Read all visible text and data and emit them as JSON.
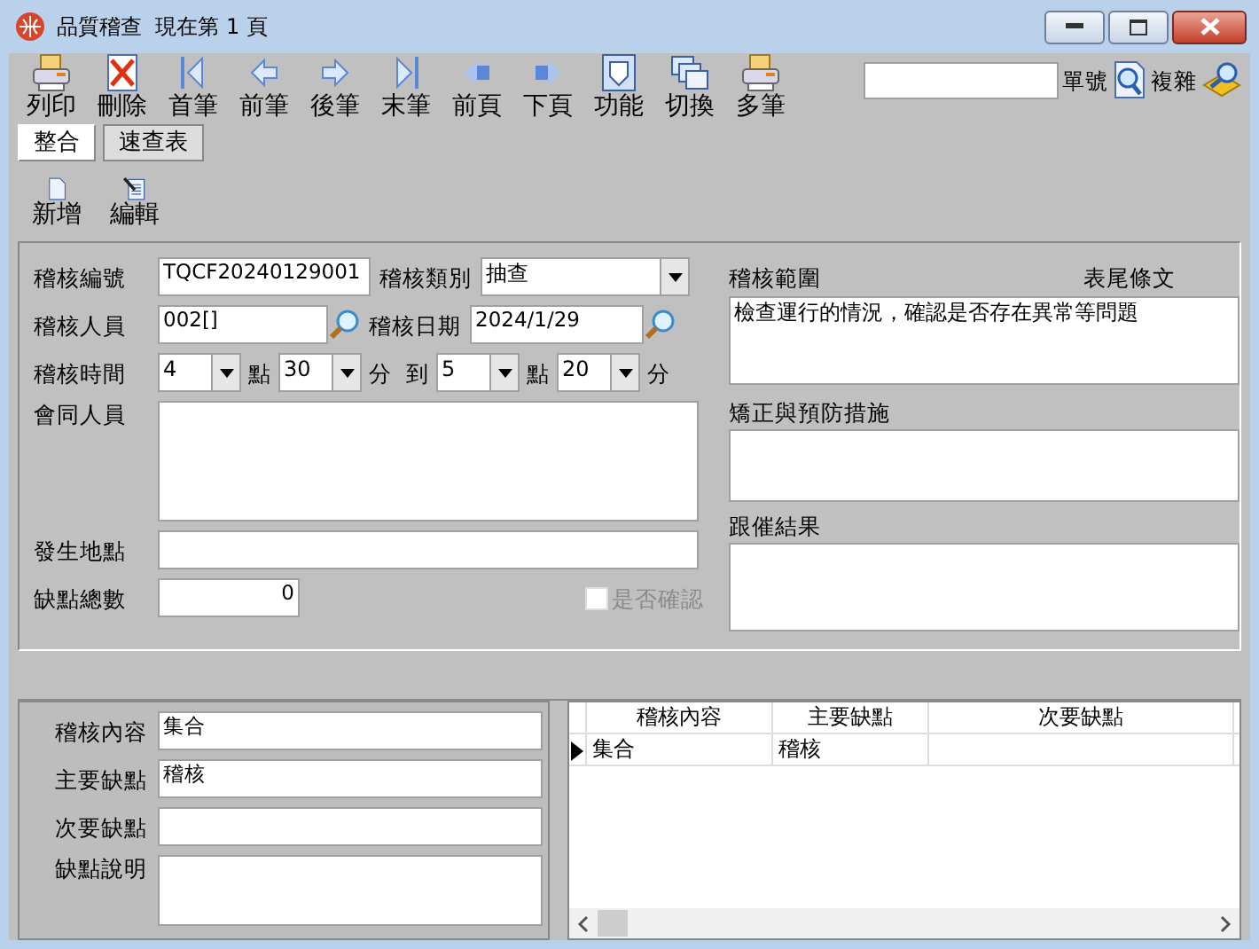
{
  "window": {
    "title": "品質稽查  現在第 1 頁"
  },
  "toolbar": [
    {
      "label": "列印",
      "kind": "print"
    },
    {
      "label": "刪除",
      "kind": "delete"
    },
    {
      "label": "首筆",
      "kind": "first"
    },
    {
      "label": "前筆",
      "kind": "prev"
    },
    {
      "label": "後筆",
      "kind": "next"
    },
    {
      "label": "末筆",
      "kind": "last"
    },
    {
      "label": "前頁",
      "kind": "prev_page"
    },
    {
      "label": "下頁",
      "kind": "next_page"
    },
    {
      "label": "功能",
      "kind": "function"
    },
    {
      "label": "切換",
      "kind": "switch"
    },
    {
      "label": "多筆",
      "kind": "print"
    }
  ],
  "search": {
    "label": "單號",
    "advanced_label": "複雜"
  },
  "tabs": [
    {
      "label": "整合",
      "selected": true
    },
    {
      "label": "速查表",
      "selected": false
    }
  ],
  "actions": [
    {
      "label": "新增",
      "kind": "new"
    },
    {
      "label": "編輯",
      "kind": "edit"
    }
  ],
  "form": {
    "audit_no": {
      "label": "稽核編號",
      "value": "TQCF20240129001"
    },
    "category": {
      "label": "稽核類別",
      "value": "抽查"
    },
    "auditor": {
      "label": "稽核人員",
      "value": "002[]"
    },
    "date": {
      "label": "稽核日期",
      "value": "2024/1/29"
    },
    "time": {
      "label": "稽核時間",
      "parts": [
        {
          "kind": "select",
          "value": "4"
        },
        {
          "kind": "text",
          "text": "點"
        },
        {
          "kind": "select",
          "value": "30"
        },
        {
          "kind": "text",
          "text": "分"
        },
        {
          "kind": "text",
          "text": "到"
        },
        {
          "kind": "select",
          "value": "5"
        },
        {
          "kind": "text",
          "text": "點"
        },
        {
          "kind": "select",
          "value": "20"
        },
        {
          "kind": "text",
          "text": "分"
        }
      ]
    },
    "participants": {
      "label": "會同人員"
    },
    "location": {
      "label": "發生地點"
    },
    "defect_total": {
      "label": "缺點總數",
      "value": "0"
    },
    "confirmed": {
      "label": "是否確認",
      "checked": false,
      "disabled": true
    },
    "scope": {
      "label": "稽核範圍",
      "footer_label": "表尾條文",
      "value": "檢查運行的情況，確認是否存在異常等問題"
    },
    "corrective": {
      "label": "矯正與預防措施"
    },
    "follow_up": {
      "label": "跟催結果"
    }
  },
  "detail": [
    {
      "label": "稽核內容",
      "value": "集合",
      "kind": "input"
    },
    {
      "label": "主要缺點",
      "value": "稽核",
      "kind": "input"
    },
    {
      "label": "次要缺點",
      "kind": "input"
    },
    {
      "label": "缺點說明",
      "kind": "textarea"
    }
  ],
  "grid": {
    "columns": [
      "稽核內容",
      "主要缺點",
      "次要缺點"
    ],
    "rows": [
      {
        "cells": [
          "集合",
          "稽核"
        ],
        "selected": true
      }
    ]
  }
}
